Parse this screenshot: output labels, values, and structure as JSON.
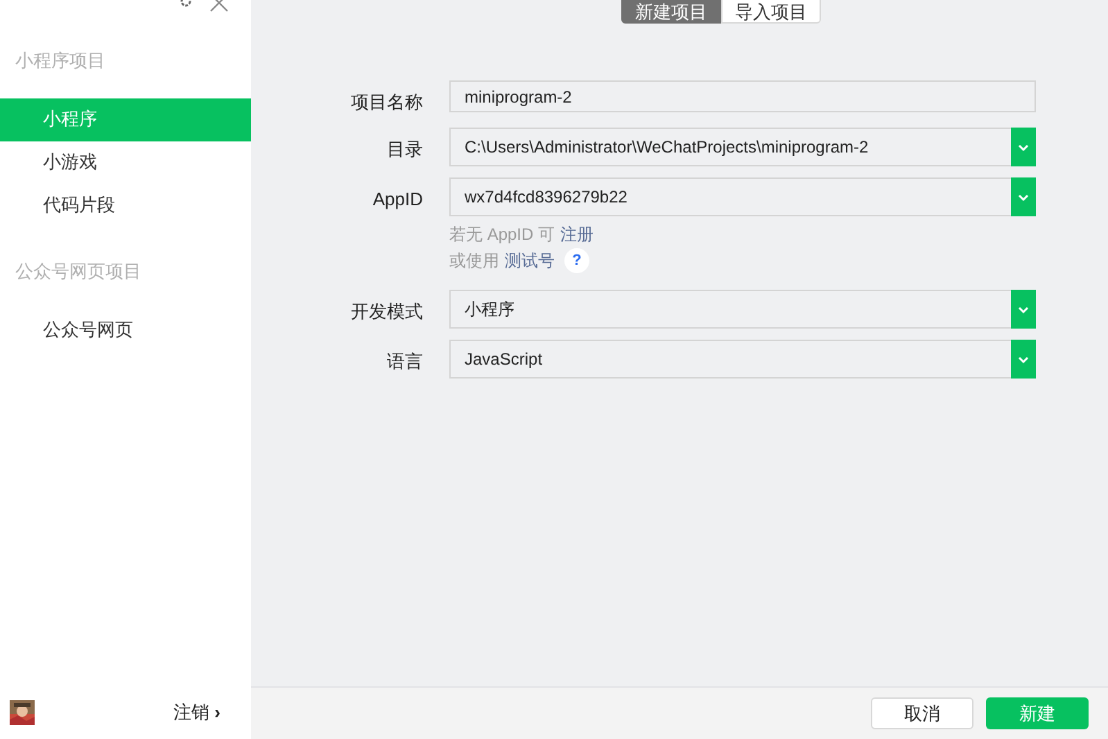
{
  "sidebar": {
    "sections": [
      {
        "title": "小程序项目",
        "items": [
          {
            "label": "小程序",
            "selected": true
          },
          {
            "label": "小游戏",
            "selected": false
          },
          {
            "label": "代码片段",
            "selected": false
          }
        ]
      },
      {
        "title": "公众号网页项目",
        "items": [
          {
            "label": "公众号网页",
            "selected": false
          }
        ]
      }
    ],
    "footer": {
      "logout": "注销",
      "chevron": "›"
    }
  },
  "tabs": [
    {
      "label": "新建项目",
      "selected": true
    },
    {
      "label": "导入项目",
      "selected": false
    }
  ],
  "form": {
    "fields": [
      {
        "label": "项目名称",
        "kind": "text",
        "value": "miniprogram-2"
      },
      {
        "label": "目录",
        "kind": "select",
        "value": "C:\\Users\\Administrator\\WeChatProjects\\miniprogram-2"
      },
      {
        "label": "AppID",
        "kind": "select",
        "value": "wx7d4fcd8396279b22",
        "hints": [
          {
            "text": "若无 AppID 可",
            "link": "注册"
          },
          {
            "text": "或使用",
            "link": "测试号",
            "help": "?"
          }
        ]
      },
      {
        "label": "开发模式",
        "kind": "select",
        "value": "小程序"
      },
      {
        "label": "语言",
        "kind": "select",
        "value": "JavaScript"
      }
    ]
  },
  "buttons": [
    {
      "label": "取消",
      "kind": "secondary"
    },
    {
      "label": "新建",
      "kind": "primary"
    }
  ]
}
